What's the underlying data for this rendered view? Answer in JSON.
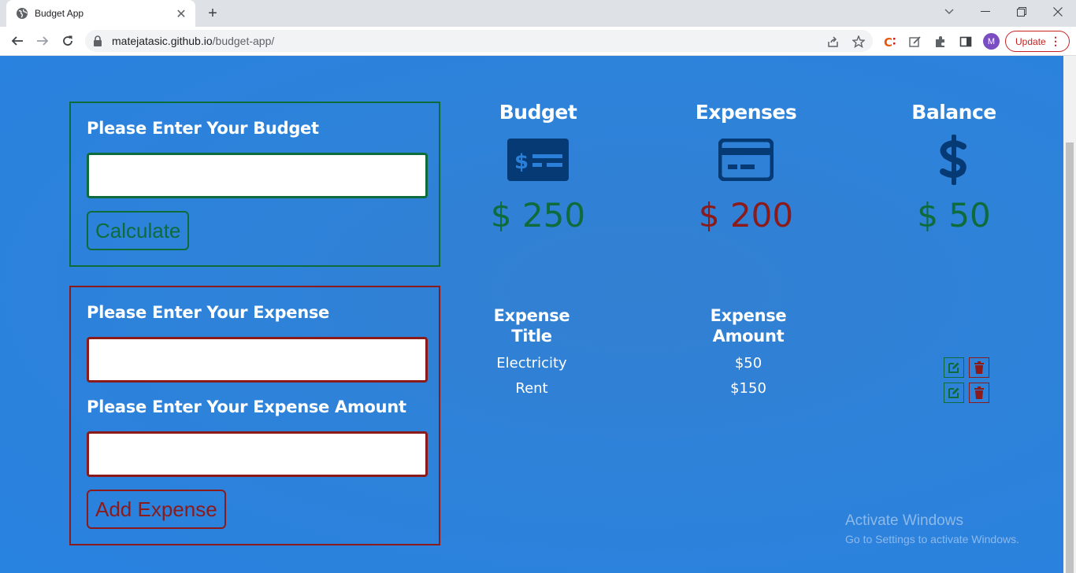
{
  "browser": {
    "tab_title": "Budget App",
    "url_host": "matejatasic.github.io",
    "url_path": "/budget-app/",
    "avatar_letter": "M",
    "update_label": "Update"
  },
  "budget_form": {
    "label": "Please Enter Your Budget",
    "value": "",
    "button_label": "Calculate"
  },
  "expense_form": {
    "title_label": "Please Enter Your Expense",
    "title_value": "",
    "amount_label": "Please Enter Your Expense Amount",
    "amount_value": "",
    "button_label": "Add Expense"
  },
  "summary": {
    "budget": {
      "title": "Budget",
      "value": "$ 250",
      "icon": "money-check-icon",
      "color": "#0e6b3c"
    },
    "expenses": {
      "title": "Expenses",
      "value": "$ 200",
      "icon": "credit-card-icon",
      "color": "#8b1a1a"
    },
    "balance": {
      "title": "Balance",
      "value": "$ 50",
      "icon": "dollar-sign-icon",
      "color": "#0e6b3c"
    }
  },
  "expense_table": {
    "header_title": "Expense Title",
    "header_amount": "Expense Amount",
    "rows": [
      {
        "title": "Electricity",
        "amount": "$50"
      },
      {
        "title": "Rent",
        "amount": "$150"
      }
    ]
  },
  "watermark": {
    "line1": "Activate Windows",
    "line2": "Go to Settings to activate Windows."
  },
  "colors": {
    "background": "#2a7fd9",
    "positive": "#0e6b3c",
    "negative": "#8b1a1a",
    "icon_dark": "#063a74"
  }
}
